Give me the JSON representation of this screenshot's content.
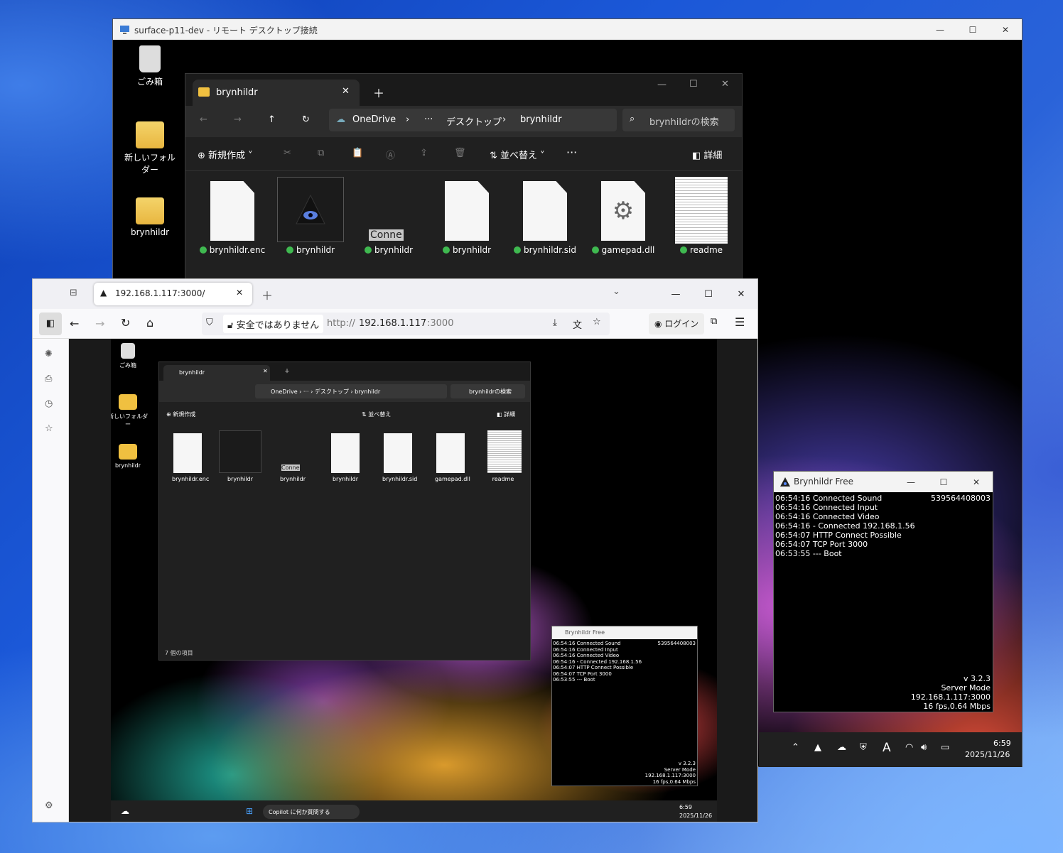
{
  "rdp": {
    "title": "surface-p11-dev - リモート デスクトップ接続"
  },
  "desktop_icons": [
    "ごみ箱",
    "新しいフォルダー",
    "brynhildr"
  ],
  "explorer": {
    "tab": "brynhildr",
    "breadcrumb": [
      "OneDrive",
      "···",
      "デスクトップ",
      "brynhildr"
    ],
    "search": "brynhildrの検索",
    "new_label": "新規作成",
    "sort_label": "並べ替え",
    "details_label": "詳細",
    "files": [
      "brynhildr.enc",
      "brynhildr",
      "brynhildr",
      "brynhildr",
      "brynhildr.sid",
      "gamepad.dll",
      "readme"
    ],
    "conne": "Conne",
    "status": "7 個の項目"
  },
  "browser": {
    "tab_title": "192.168.1.117:3000/",
    "insecure": "安全ではありません",
    "url_prefix": "http://",
    "url_host": "192.168.1.117",
    "url_port": ":3000",
    "login": "ログイン"
  },
  "brynhildr": {
    "title": "Brynhildr Free",
    "id": "539564408003",
    "log": [
      "06:54:16 Connected Sound",
      "06:54:16 Connected Input",
      "06:54:16 Connected Video",
      "06:54:16 - Connected 192.168.1.56",
      "06:54:07 HTTP Connect Possible",
      "06:54:07 TCP Port 3000",
      "06:53:55 --- Boot"
    ],
    "status": [
      "v 3.2.3",
      "Server Mode",
      "192.168.1.117:3000",
      "16 fps,0.64 Mbps"
    ]
  },
  "taskbar": {
    "time": "6:59",
    "date": "2025/11/26",
    "copilot": "Copilot に何か質問する"
  },
  "colors": {
    "accent": "#0078d4",
    "check": "#3fb950",
    "folder": "#f0c040"
  }
}
